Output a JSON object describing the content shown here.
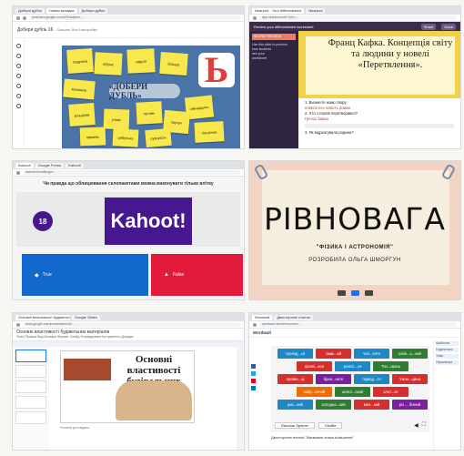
{
  "tile1": {
    "tabs": [
      "Добери дубль",
      "Новая вкладка",
      "Добери дубль"
    ],
    "url": "jamboard.google.com/d/1hAqNew...",
    "doc_title": "Добери дубль 16",
    "menu": "Скачать  Фон  Настройки",
    "banner": "«ДОБЕРИ ДУБЛЬ»",
    "big_letter": "Ь",
    "stickies": [
      "подушка",
      "вітряк",
      "сядьте",
      "більше",
      "малюнок",
      "сімнадцять",
      "кільцями",
      "учнях",
      "кутник",
      "каучук",
      "промінь",
      "цибулька",
      "гільзочка",
      "суворість"
    ],
    "colors": {
      "board": "#4a73a8",
      "sticky": "#f8e84b",
      "letter": "#e13d3d"
    }
  },
  "tile2": {
    "tabs": [
      "Nearpod - Your differentiated",
      "Nearpod"
    ],
    "url": "app.nearpod.com/?pin=...",
    "topbar_title": "Review your differentiated worksheet",
    "topbar_buttons": [
      "Share",
      "Done"
    ],
    "side_header": "SELFIE PREVIEW",
    "side_lines": [
      "Use this slide to preview",
      "how students",
      "see your",
      "worksheet"
    ],
    "slide_title": "Франц Кафка. Концепція світу та людини у новелі «Перетвлення».",
    "quiz_lines": [
      "1. Визначте жанр твору:",
      "новела  есе  повість  роман",
      "2. Хто з героїв перетворився?",
      "Грегор Замза",
      "3. Як відреагувала родина?"
    ]
  },
  "tile3": {
    "tabs": [
      "Kahoot!",
      "Google Forms",
      "Kahoot!"
    ],
    "url": "kahoot.it/challenge/...",
    "question": "Чи правда що облицювання склопакетами можна виконувати тільки влітку",
    "counter": "18",
    "logo": "Kahoot!",
    "answers": [
      {
        "shape": "◆",
        "label": "True"
      },
      {
        "shape": "▲",
        "label": "False"
      }
    ],
    "colors": {
      "brand": "#46178f",
      "true": "#1368ce",
      "false": "#e21b3c"
    }
  },
  "tile4": {
    "title": "РІВНОВАГА",
    "subtitle": "\"ФІЗИКА І АСТРОНОМІЯ\"",
    "author": "РОЗРОБИЛА  ОЛЬГА ШМОРГУН"
  },
  "tile5": {
    "tabs": [
      "Основні властивості будівельних",
      "Google Slides"
    ],
    "url": "docs.google.com/presentation/d/...",
    "doc_title": "Основні властивості будівельних матеріалів",
    "menus": "Файл  Правка  Вид  Вставка  Формат  Слайд  Упорядкувати  Інструменти  Довідка",
    "slide_title": "Основні властивості будівельних матеріалів",
    "notes": "Нотатки доповідача"
  },
  "tile6": {
    "tabs": [
      "Wordwall",
      "Двосторонні плитки"
    ],
    "url": "wordwall.net/uk/resource/...",
    "brand": "Wordwall",
    "chips": [
      {
        "text": "троянд...ся",
        "color": "#1e88c7"
      },
      {
        "text": "смак...ий",
        "color": "#d32f2f"
      },
      {
        "text": "чон...ачте",
        "color": "#1e88c7"
      },
      {
        "text": "Ірпін...ь...кий",
        "color": "#2e7d32"
      },
      {
        "text": "цікаві...ися",
        "color": "#d32f2f"
      },
      {
        "text": "розпіс...ся",
        "color": "#1e88c7"
      },
      {
        "text": "Тон...Шань",
        "color": "#2e7d32"
      },
      {
        "text": "промін...ці",
        "color": "#d32f2f"
      },
      {
        "text": "брин...ните",
        "color": "#7b1fa2"
      },
      {
        "text": "підвод...ся",
        "color": "#1e88c7"
      },
      {
        "text": "Ужан...цина",
        "color": "#d32f2f"
      },
      {
        "text": "хабр...овчий",
        "color": "#ef6c00"
      },
      {
        "text": "ангел...ский",
        "color": "#2e7d32"
      },
      {
        "text": "злот...ся",
        "color": "#d32f2f"
      },
      {
        "text": "рис...кий",
        "color": "#1e88c7"
      },
      {
        "text": "холодна...кий",
        "color": "#2e7d32"
      },
      {
        "text": "мен...кий",
        "color": "#d32f2f"
      },
      {
        "text": "різ ... бізний",
        "color": "#7b1fa2"
      }
    ],
    "buttons": [
      "Random Spinner",
      "Shuffle"
    ],
    "footer": "Двосторонні плитки \"Вживання знака м'якшення\"",
    "right_panel": [
      "Шаблони",
      "Поділитися",
      "Теми",
      "Параметри"
    ]
  }
}
